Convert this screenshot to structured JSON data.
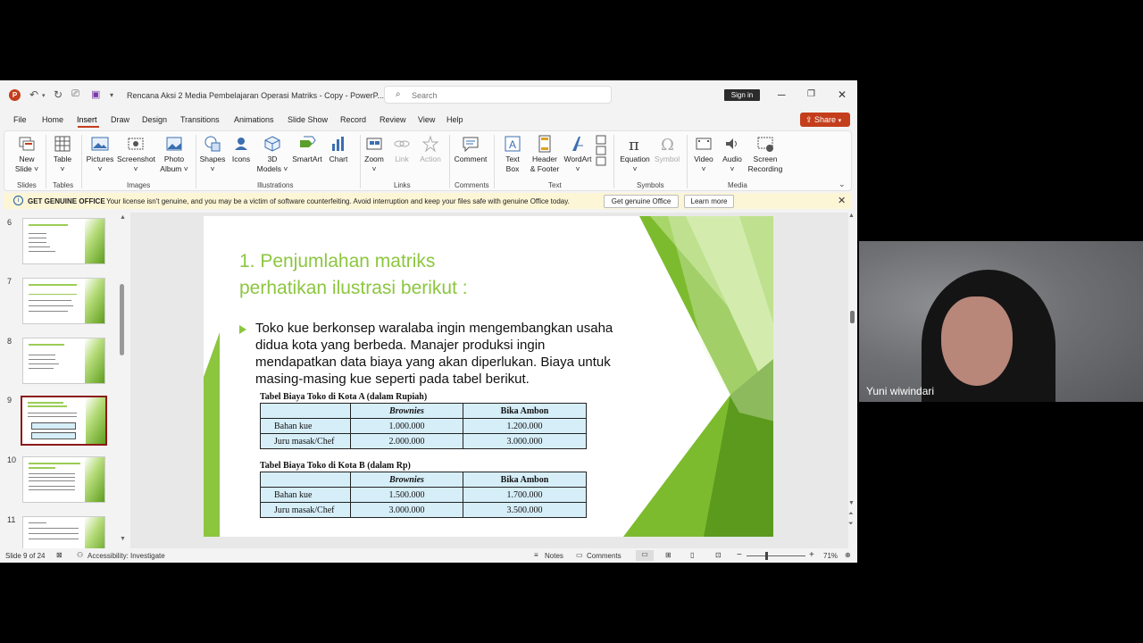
{
  "window": {
    "doc_title": "Rencana Aksi 2 Media Pembelajaran Operasi Matriks - Copy  -  PowerP...",
    "search_placeholder": "Search",
    "sign_in": "Sign in",
    "app_icon": "P"
  },
  "menu": {
    "tabs": [
      "File",
      "Home",
      "Insert",
      "Draw",
      "Design",
      "Transitions",
      "Animations",
      "Slide Show",
      "Record",
      "Review",
      "View",
      "Help"
    ],
    "active_tab": "Insert",
    "share": "Share"
  },
  "ribbon": {
    "new_slide": [
      "New",
      "Slide ˅"
    ],
    "table": [
      "Table",
      "˅"
    ],
    "pictures": [
      "Pictures",
      "˅"
    ],
    "screenshot": [
      "Screenshot",
      "˅"
    ],
    "photo_album": [
      "Photo",
      "Album ˅"
    ],
    "shapes": [
      "Shapes",
      "˅"
    ],
    "icons": [
      "Icons",
      ""
    ],
    "models3d": [
      "3D",
      "Models ˅"
    ],
    "smartart": [
      "SmartArt",
      ""
    ],
    "chart": [
      "Chart",
      ""
    ],
    "zoom": [
      "Zoom",
      "˅"
    ],
    "link": [
      "Link",
      ""
    ],
    "action": [
      "Action",
      ""
    ],
    "comment": [
      "Comment",
      ""
    ],
    "textbox": [
      "Text",
      "Box"
    ],
    "header_footer": [
      "Header",
      "& Footer"
    ],
    "wordart": [
      "WordArt",
      "˅"
    ],
    "equation": [
      "Equation",
      "˅"
    ],
    "symbol": [
      "Symbol",
      ""
    ],
    "video": [
      "Video",
      "˅"
    ],
    "audio": [
      "Audio",
      "˅"
    ],
    "screen_recording": [
      "Screen",
      "Recording"
    ],
    "groups": [
      "Slides",
      "Tables",
      "Images",
      "Illustrations",
      "Links",
      "Comments",
      "Text",
      "Symbols",
      "Media"
    ]
  },
  "notification": {
    "title": "GET GENUINE OFFICE",
    "message": "Your license isn't genuine, and you may be a victim of software counterfeiting. Avoid interruption and keep your files safe with genuine Office today.",
    "btn_genuine": "Get genuine Office",
    "btn_learn": "Learn more"
  },
  "thumbnails": [
    "6",
    "7",
    "8",
    "9",
    "10",
    "11"
  ],
  "selected_slide": "9",
  "slide": {
    "title_line1": "1. Penjumlahan matriks",
    "title_line2": "perhatikan ilustrasi berikut :",
    "bullet": "Toko kue berkonsep waralaba ingin mengembangkan usaha didua kota yang berbeda. Manajer produksi ingin mendapatkan data biaya yang akan diperlukan. Biaya untuk masing-masing kue seperti pada tabel berikut.",
    "table_a": {
      "title": "Tabel Biaya Toko di Kota A (dalam Rupiah)",
      "headers": [
        "",
        "Brownies",
        "Bika Ambon"
      ],
      "rows": [
        [
          "Bahan kue",
          "1.000.000",
          "1.200.000"
        ],
        [
          "Juru masak/Chef",
          "2.000.000",
          "3.000.000"
        ]
      ]
    },
    "table_b": {
      "title": "Tabel Biaya Toko di Kota B (dalam Rp)",
      "headers": [
        "",
        "Brownies",
        "Bika Ambon"
      ],
      "rows": [
        [
          "Bahan kue",
          "1.500.000",
          "1.700.000"
        ],
        [
          "Juru masak/Chef",
          "3.000.000",
          "3.500.000"
        ]
      ]
    }
  },
  "status": {
    "slide_count": "Slide 9 of 24",
    "accessibility": "Accessibility: Investigate",
    "notes": "Notes",
    "comments": "Comments",
    "zoom": "71%"
  },
  "webcam": {
    "participant": "Yuni wiwindari"
  },
  "colors": {
    "accent": "#c43e1c",
    "slide_green": "#8cc63f",
    "table_fill": "#d6eef8"
  }
}
